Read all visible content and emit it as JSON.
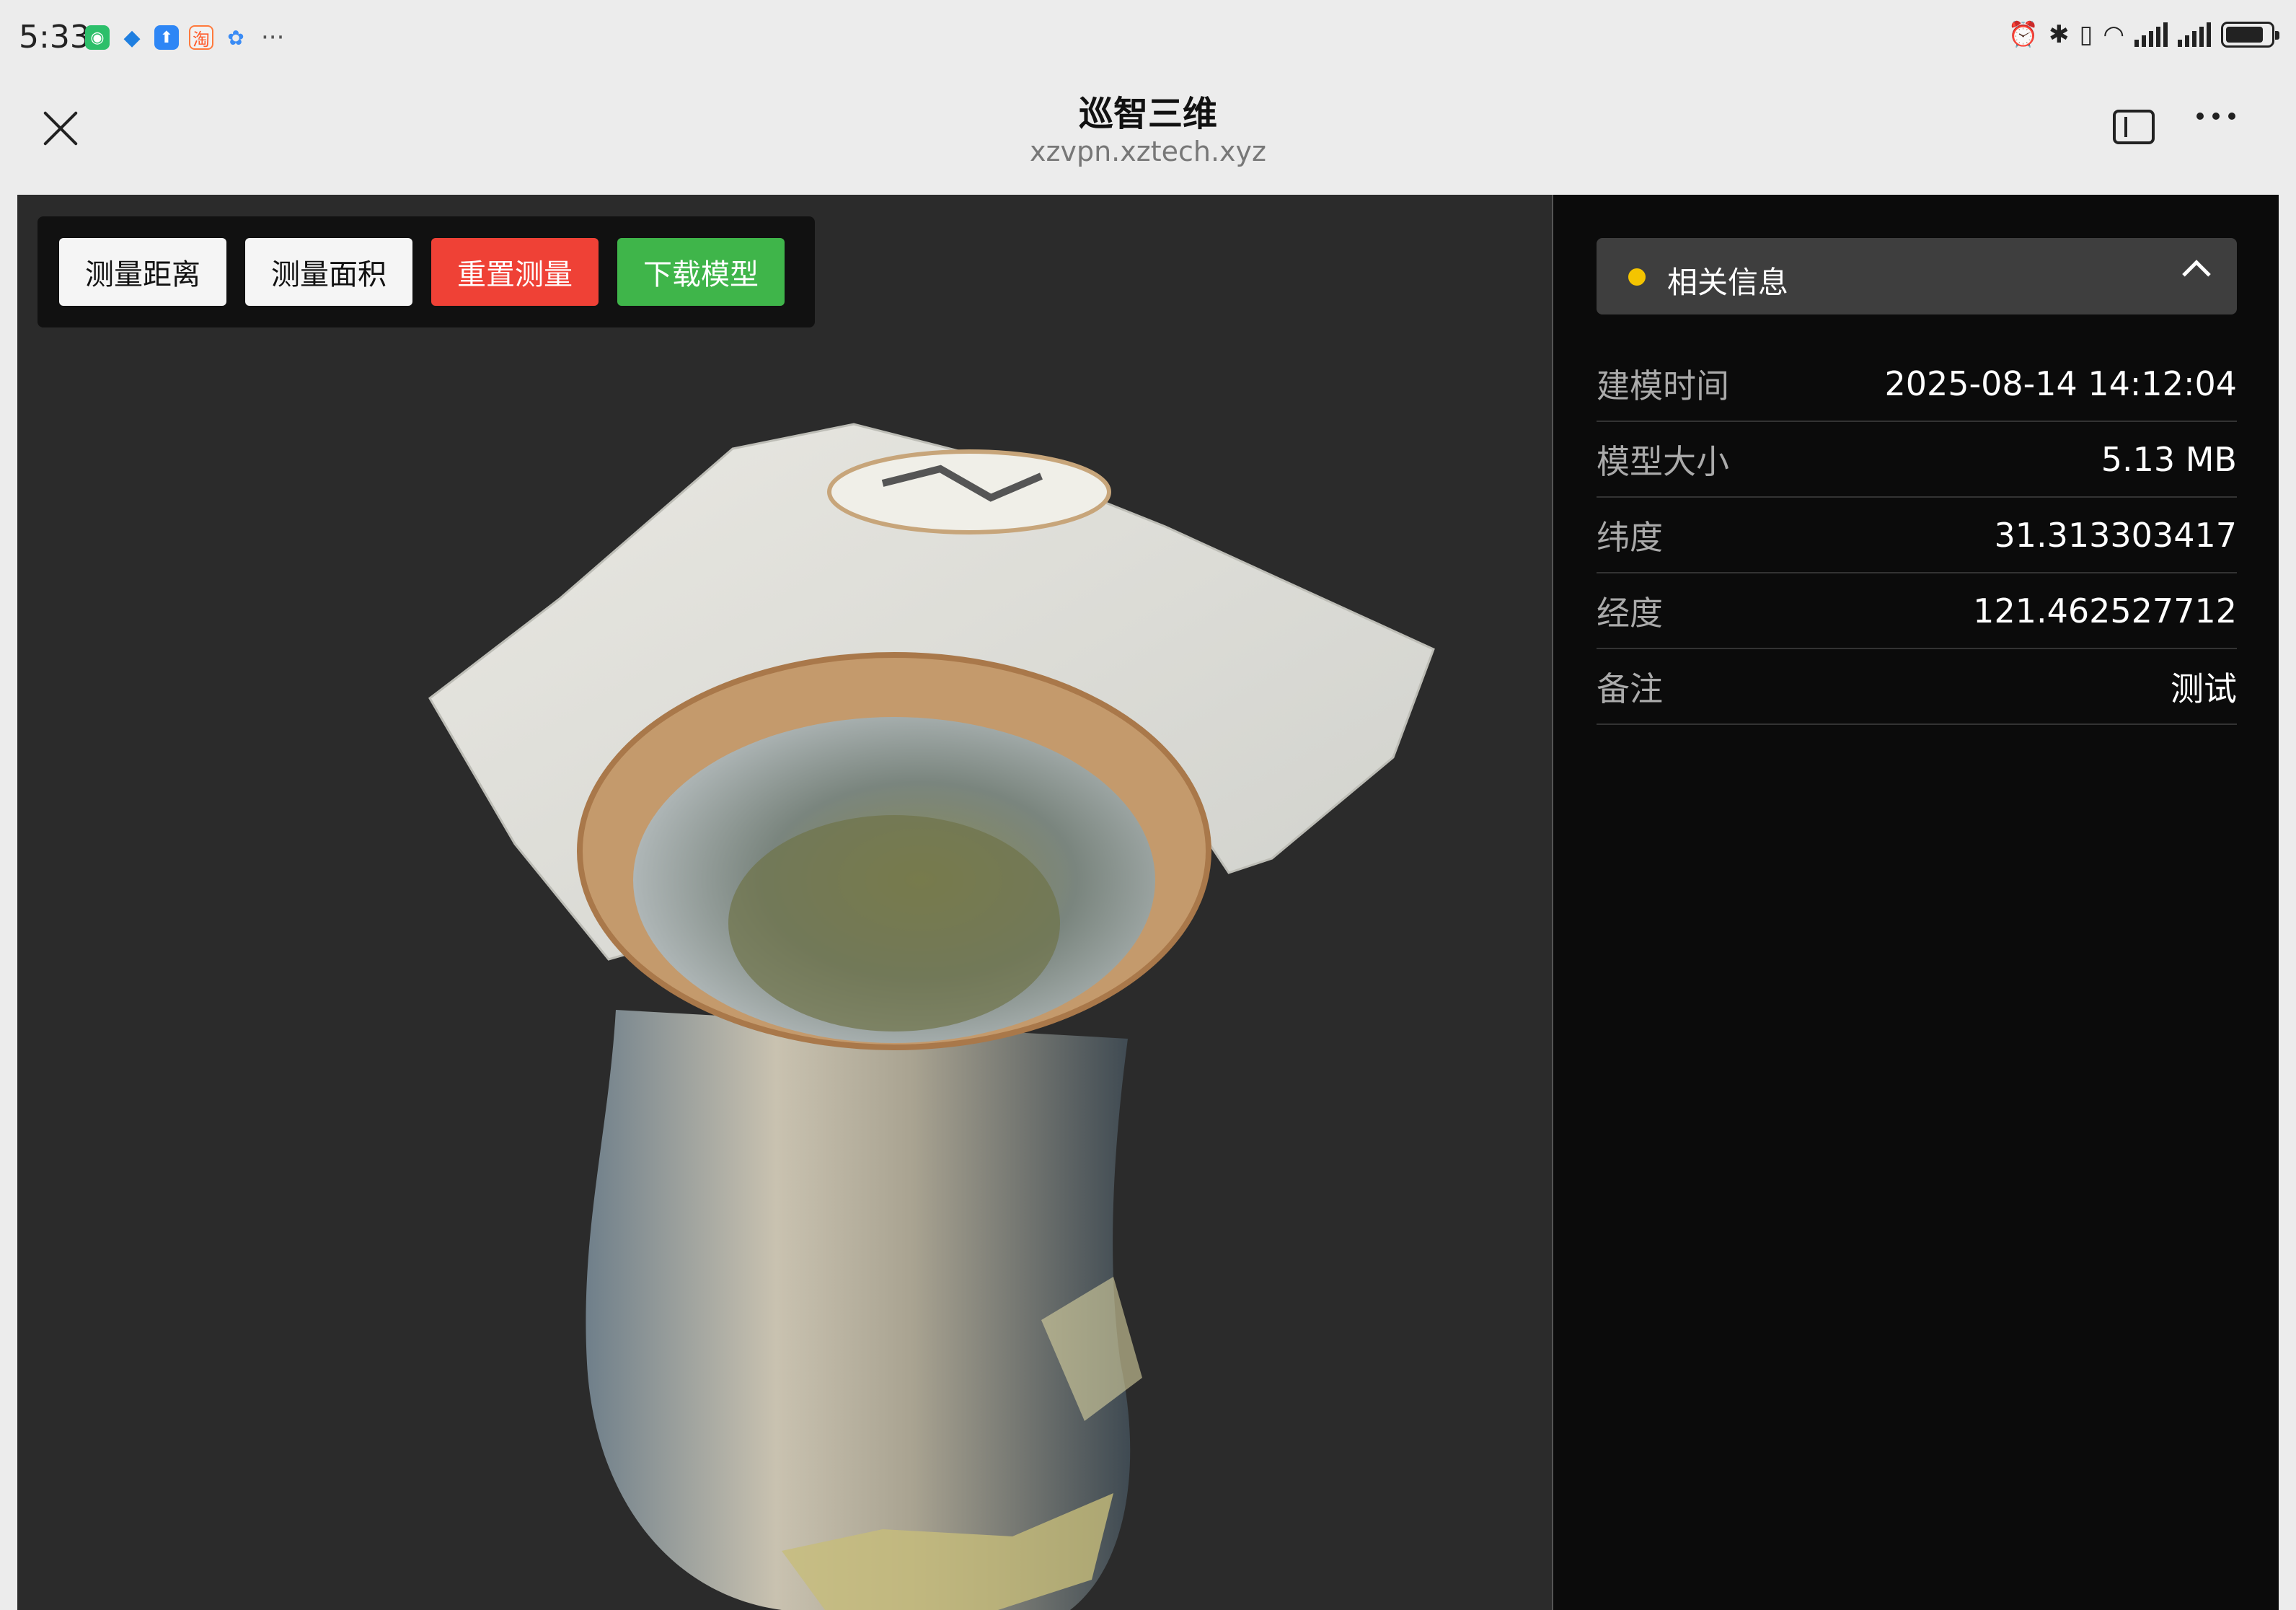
{
  "status_bar": {
    "time": "5:33",
    "more": "···",
    "notification_icons": [
      "wechat-icon",
      "bird-icon",
      "upload-app-icon",
      "taobao-icon",
      "map-app-icon"
    ],
    "system_icons": [
      "alarm-icon",
      "bluetooth-icon",
      "vibrate-icon",
      "wifi-icon",
      "signal-icon",
      "signal-icon",
      "battery-icon"
    ],
    "battery_level": 0.85
  },
  "browser": {
    "title": "巡智三维",
    "url": "xzvpn.xztech.xyz"
  },
  "toolbar": {
    "measure_distance": "测量距离",
    "measure_area": "测量面积",
    "reset_measure": "重置测量",
    "download_model": "下载模型"
  },
  "info_panel": {
    "header": "相关信息",
    "rows": [
      {
        "label": "建模时间",
        "value": "2025-08-14 14:12:04"
      },
      {
        "label": "模型大小",
        "value": "5.13 MB"
      },
      {
        "label": "纬度",
        "value": "31.313303417"
      },
      {
        "label": "经度",
        "value": "121.462527712"
      },
      {
        "label": "备注",
        "value": "测试"
      }
    ]
  },
  "colors": {
    "viewer_bg": "#2b2b2b",
    "panel_bg": "#0b0b0b",
    "reset_button": "#ef4136",
    "download_button": "#3fb54a",
    "status_dot": "#f4c400"
  }
}
